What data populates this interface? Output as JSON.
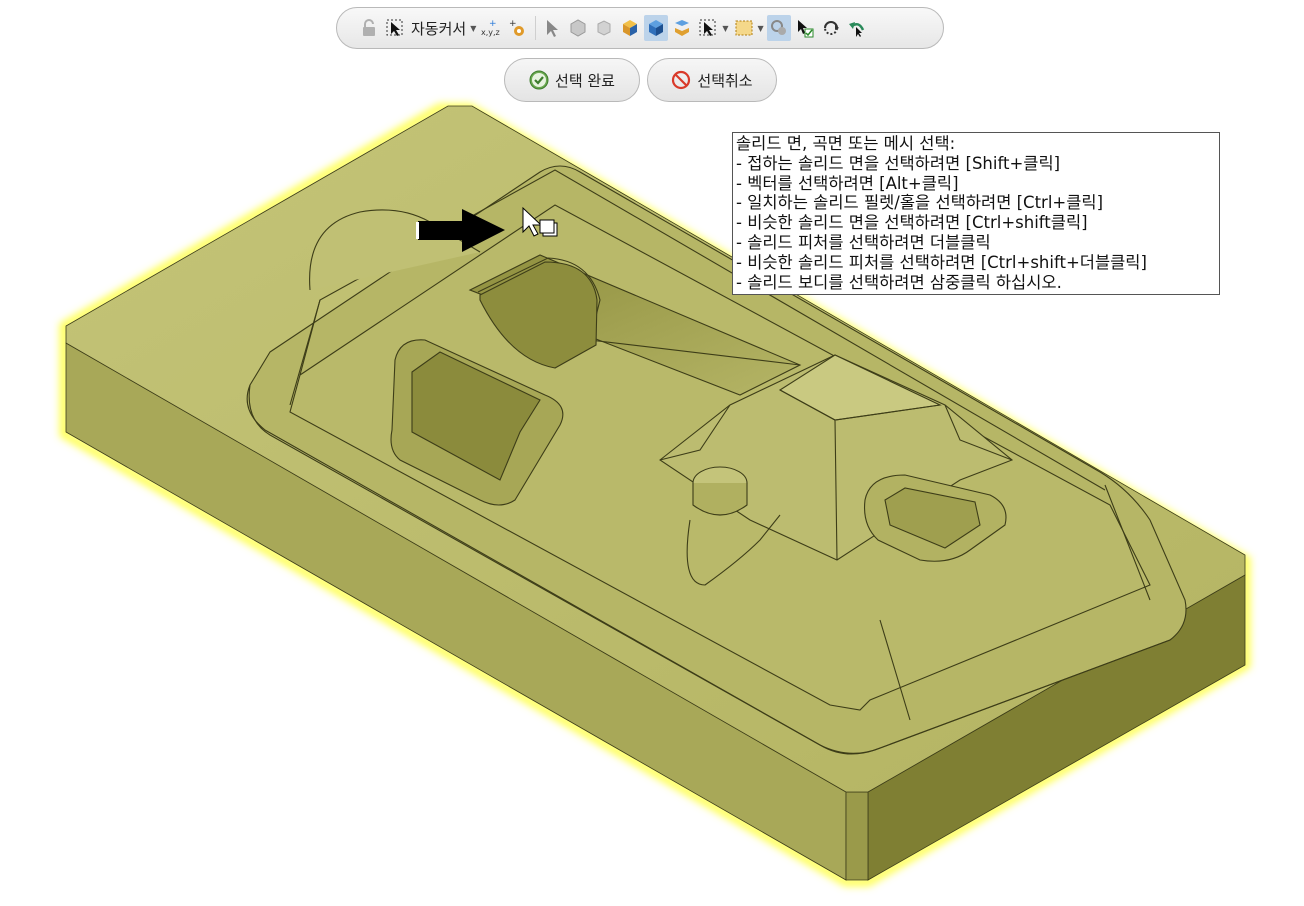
{
  "toolbar": {
    "lock_icon": "lock-icon",
    "cursor_mode_label": "자동커서",
    "icons": [
      "auto-cursor-icon",
      "coordinate-xyz-icon",
      "gear-add-icon",
      "select-arrow-icon",
      "solid-face-icon",
      "solid-face-alt-icon",
      "solid-body-icon",
      "solid-blue-icon",
      "solid-stack-icon",
      "select-rect-icon",
      "box-select-icon",
      "select-filter-icon",
      "select-confirm-icon",
      "rotate-view-icon",
      "undo-select-icon"
    ]
  },
  "actions": {
    "done_label": "선택 완료",
    "cancel_label": "선택취소"
  },
  "help": {
    "lines": [
      "솔리드 면, 곡면 또는 메시 선택:",
      "- 접하는 솔리드 면을 선택하려면 [Shift+클릭]",
      "- 벡터를 선택하려면 [Alt+클릭]",
      "- 일치하는 솔리드 필렛/홀을 선택하려면 [Ctrl+클릭]",
      "- 비슷한 솔리드 면을 선택하려면 [Ctrl+shift클릭]",
      "- 솔리드 피처를 선택하려면 더블클릭",
      "- 비슷한 솔리드 피처를 선택하려면 [Ctrl+shift+더블클릭]",
      "- 솔리드 보디를 선택하려면 삼중클릭 하십시오."
    ]
  },
  "colors": {
    "model_top": "#bdbd6c",
    "model_left": "#a9a95a",
    "model_right": "#7f7f33",
    "highlight": "#ffff66",
    "edge": "#3d3d18",
    "toolbar_active": "#bcd3ea"
  }
}
